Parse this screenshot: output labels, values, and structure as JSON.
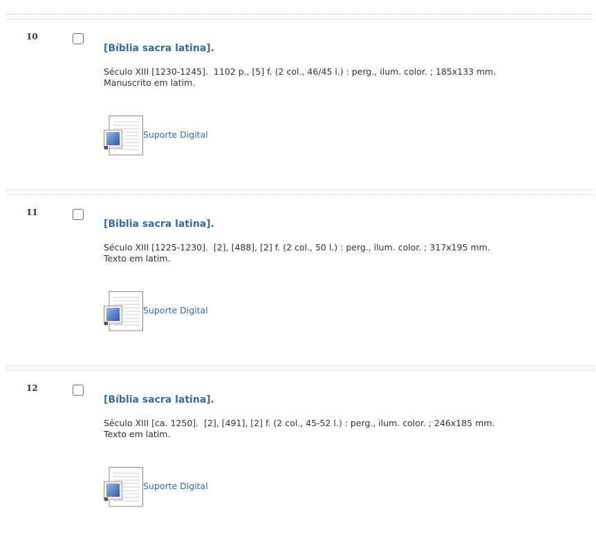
{
  "records": [
    {
      "number": "10",
      "title": "[Bíblia sacra latina].",
      "description_line1": "Século XIII [1230-1245].  1102 p., [5] f. (2 col., 46/45 l.) : perg., ilum. color. ; 185x133 mm.",
      "description_line2": "Manuscrito em latim.",
      "digital_link": "Suporte Digital",
      "icon": "digital-document-icon"
    },
    {
      "number": "11",
      "title": "[Biblia sacra latina].",
      "description_line1": "Século XIII [1225-1230].  [2], [488], [2] f. (2 col., 50 l.) : perg., ilum. color. ; 317x195 mm.",
      "description_line2": "Texto em latim.",
      "digital_link": "Suporte Digital",
      "icon": "digital-document-icon"
    },
    {
      "number": "12",
      "title": "[Bíblia sacra latina].",
      "description_line1": "Século XIII [ca. 1250].  [2], [491], [2] f. (2 col., 45-52 l.) : perg., ilum. color. ; 246x185 mm.",
      "description_line2": "Texto em latim.",
      "digital_link": "Suporte Digital",
      "icon": "digital-document-icon"
    }
  ],
  "colors": {
    "link": "#3b6a9b",
    "text": "#333333",
    "separator": "#c9c9c9",
    "icon_blue": "#3d6ab8"
  }
}
